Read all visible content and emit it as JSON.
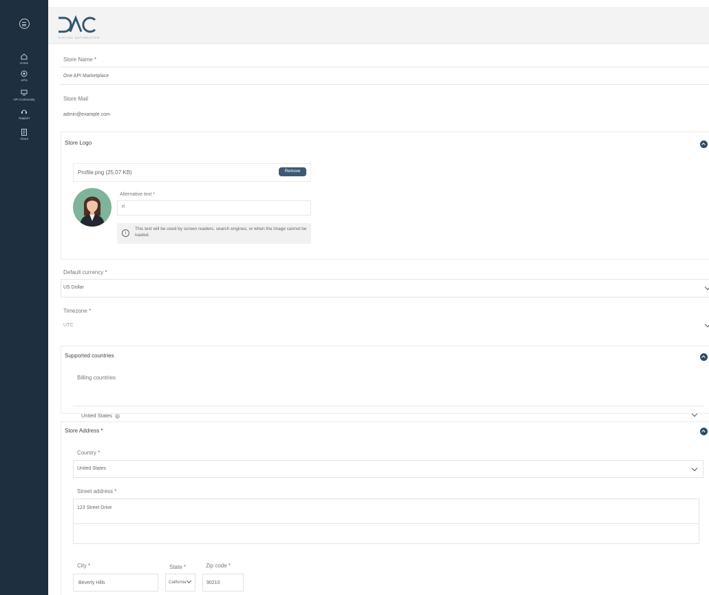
{
  "sidebar": {
    "items": [
      {
        "label": "Home",
        "icon": "home-icon"
      },
      {
        "label": "APIs",
        "icon": "api-icon"
      },
      {
        "label": "API Community",
        "icon": "community-icon"
      },
      {
        "label": "Support",
        "icon": "support-icon"
      },
      {
        "label": "About",
        "icon": "about-icon"
      }
    ]
  },
  "header": {
    "logo_text": "DAC",
    "logo_subtext": "DIGITAL AUTOMATION"
  },
  "form": {
    "store_name_label": "Store Name *",
    "store_name_value": "One API Marketplace",
    "store_mail_label": "Store Mail",
    "store_mail_value": "admin@example.com",
    "store_logo": {
      "title": "Store Logo",
      "file_name": "Profile.png (25.07 KB)",
      "remove_label": "Remove",
      "alt_label": "Alternative text *",
      "alt_value": "rl",
      "info_text": "This text will be used by screen readers, search engines, or when the image cannot be loaded."
    },
    "currency_label": "Default currency *",
    "currency_value": "US Dollar",
    "timezone_label": "Timezone *",
    "timezone_value": "UTC",
    "supported_countries": {
      "title": "Supported countries",
      "billing_label": "Billing countries",
      "chips": [
        "United States"
      ]
    },
    "store_address": {
      "title": "Store Address *",
      "country_label": "Country *",
      "country_value": "United States",
      "street_label": "Street address *",
      "street_value": "123 Street Drive",
      "city_label": "City *",
      "city_value": "Beverly Hills",
      "state_label": "State *",
      "state_value": "California",
      "zip_label": "Zip code *",
      "zip_value": "90210"
    }
  },
  "colors": {
    "sidebar": "#1e2f3f",
    "accent": "#2f4b63",
    "button": "#3d5a74"
  }
}
